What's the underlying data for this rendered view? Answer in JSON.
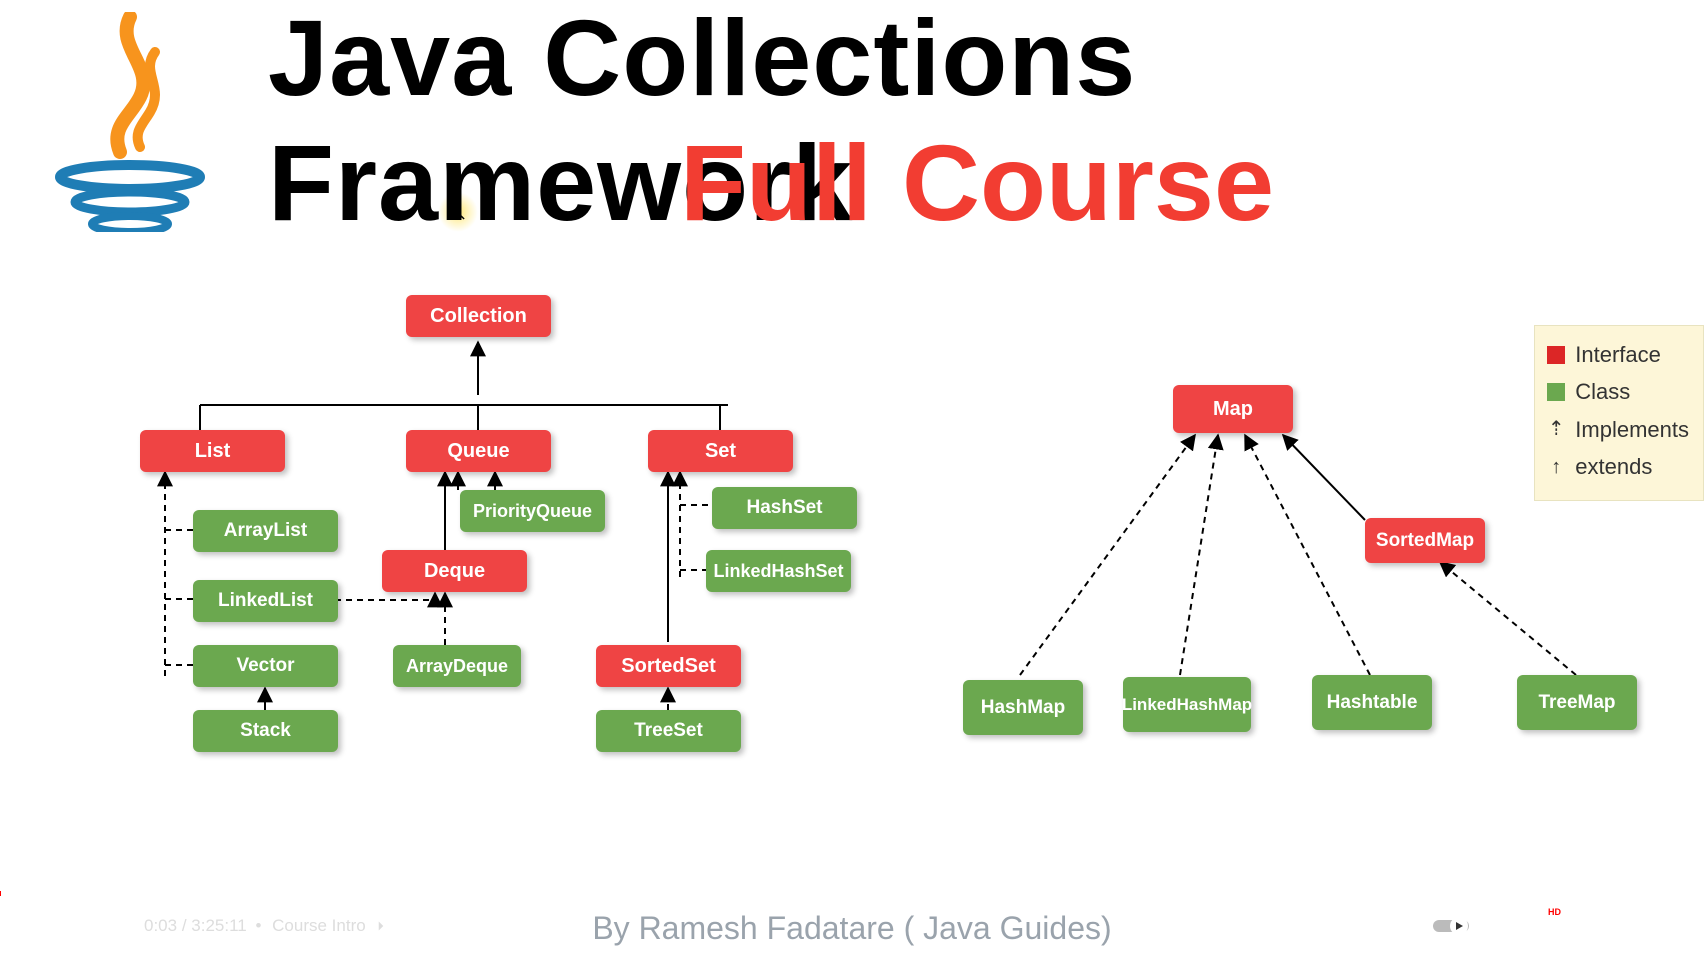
{
  "title_line1": "Java Collections Framework",
  "title_line2": "Full Course",
  "author_line": "By Ramesh Fadatare ( Java Guides)",
  "legend": {
    "interface": "Interface",
    "class": "Class",
    "implements": "Implements",
    "extends": "extends"
  },
  "nodes": {
    "collection": "Collection",
    "list": "List",
    "queue": "Queue",
    "set": "Set",
    "arraylist": "ArrayList",
    "linkedlist": "LinkedList",
    "vector": "Vector",
    "stack": "Stack",
    "priorityqueue": "PriorityQueue",
    "deque": "Deque",
    "arraydeque": "ArrayDeque",
    "hashset": "HashSet",
    "linkedhashset": "LinkedHashSet",
    "sortedset": "SortedSet",
    "treeset": "TreeSet",
    "map": "Map",
    "sortedmap": "SortedMap",
    "hashmap": "HashMap",
    "linkedhashmap": "LinkedHashMap",
    "hashtable": "Hashtable",
    "treemap": "TreeMap"
  },
  "player": {
    "time_current": "0:03",
    "time_total": "3:25:11",
    "chapter": "Course Intro",
    "quality": "HD"
  },
  "diagram": {
    "type": "hierarchy",
    "legend": [
      {
        "color": "red",
        "meaning": "Interface"
      },
      {
        "color": "green",
        "meaning": "Class"
      },
      {
        "line": "dashed-arrow",
        "meaning": "Implements"
      },
      {
        "line": "solid-arrow",
        "meaning": "extends"
      }
    ],
    "roots": [
      "Collection",
      "Map"
    ],
    "edges": [
      {
        "from": "List",
        "to": "Collection",
        "rel": "extends"
      },
      {
        "from": "Queue",
        "to": "Collection",
        "rel": "extends"
      },
      {
        "from": "Set",
        "to": "Collection",
        "rel": "extends"
      },
      {
        "from": "ArrayList",
        "to": "List",
        "rel": "implements"
      },
      {
        "from": "LinkedList",
        "to": "List",
        "rel": "implements"
      },
      {
        "from": "Vector",
        "to": "List",
        "rel": "implements"
      },
      {
        "from": "Stack",
        "to": "Vector",
        "rel": "extends"
      },
      {
        "from": "PriorityQueue",
        "to": "Queue",
        "rel": "implements"
      },
      {
        "from": "Deque",
        "to": "Queue",
        "rel": "extends"
      },
      {
        "from": "LinkedList",
        "to": "Deque",
        "rel": "implements"
      },
      {
        "from": "ArrayDeque",
        "to": "Deque",
        "rel": "implements"
      },
      {
        "from": "HashSet",
        "to": "Set",
        "rel": "implements"
      },
      {
        "from": "LinkedHashSet",
        "to": "Set",
        "rel": "implements"
      },
      {
        "from": "SortedSet",
        "to": "Set",
        "rel": "extends"
      },
      {
        "from": "TreeSet",
        "to": "SortedSet",
        "rel": "implements"
      },
      {
        "from": "SortedMap",
        "to": "Map",
        "rel": "extends"
      },
      {
        "from": "HashMap",
        "to": "Map",
        "rel": "implements"
      },
      {
        "from": "LinkedHashMap",
        "to": "Map",
        "rel": "implements"
      },
      {
        "from": "Hashtable",
        "to": "Map",
        "rel": "implements"
      },
      {
        "from": "TreeMap",
        "to": "SortedMap",
        "rel": "implements"
      }
    ],
    "node_types": {
      "Collection": "interface",
      "List": "interface",
      "Queue": "interface",
      "Set": "interface",
      "Deque": "interface",
      "SortedSet": "interface",
      "Map": "interface",
      "SortedMap": "interface",
      "ArrayList": "class",
      "LinkedList": "class",
      "Vector": "class",
      "Stack": "class",
      "PriorityQueue": "class",
      "ArrayDeque": "class",
      "HashSet": "class",
      "LinkedHashSet": "class",
      "TreeSet": "class",
      "HashMap": "class",
      "LinkedHashMap": "class",
      "Hashtable": "class",
      "TreeMap": "class"
    }
  }
}
